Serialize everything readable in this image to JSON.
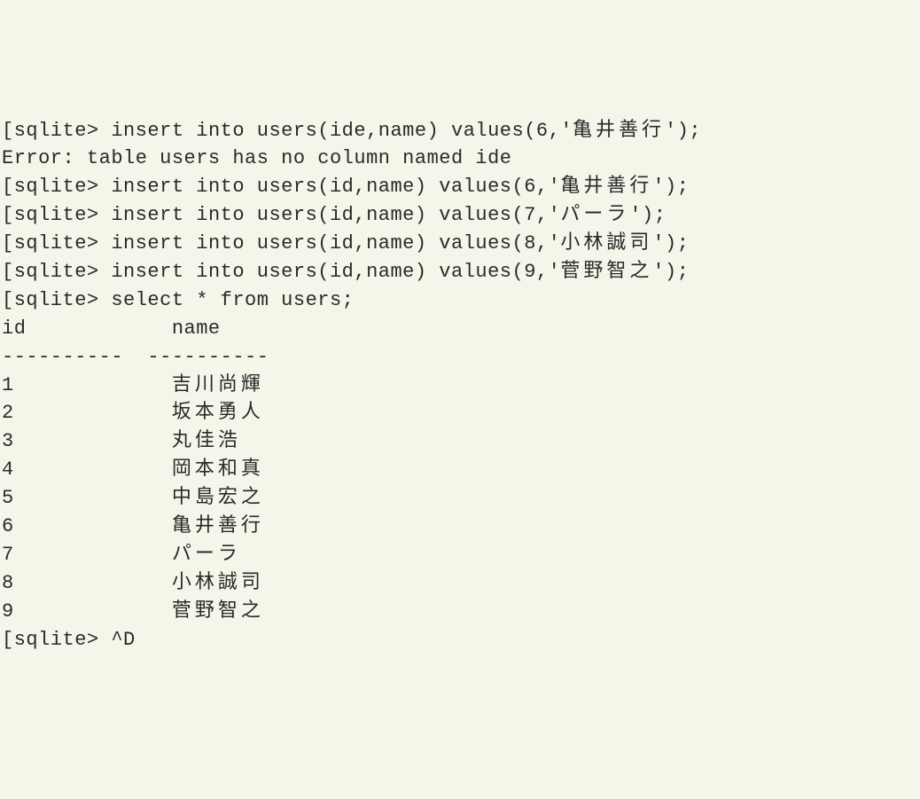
{
  "terminal": {
    "prompt": "sqlite> ",
    "commands": [
      {
        "text": "insert into users(ide,name) values(6,'",
        "cjk": "亀井善行",
        "suffix": "');"
      },
      {
        "error": "Error: table users has no column named ide"
      },
      {
        "text": "insert into users(id,name) values(6,'",
        "cjk": "亀井善行",
        "suffix": "');"
      },
      {
        "text": "insert into users(id,name) values(7,'",
        "cjk": "パーラ",
        "suffix": "');"
      },
      {
        "text": "insert into users(id,name) values(8,'",
        "cjk": "小林誠司",
        "suffix": "');"
      },
      {
        "text": "insert into users(id,name) values(9,'",
        "cjk": "菅野智之",
        "suffix": "');"
      },
      {
        "text": "select * from users;"
      }
    ],
    "result_header": {
      "col1": "id",
      "col2": "name",
      "sep1": "----------",
      "sep2": "----------"
    },
    "result_rows": [
      {
        "id": "1",
        "name": "吉川尚輝"
      },
      {
        "id": "2",
        "name": "坂本勇人"
      },
      {
        "id": "3",
        "name": "丸佳浩"
      },
      {
        "id": "4",
        "name": "岡本和真"
      },
      {
        "id": "5",
        "name": "中島宏之"
      },
      {
        "id": "6",
        "name": "亀井善行"
      },
      {
        "id": "7",
        "name": "パーラ"
      },
      {
        "id": "8",
        "name": "小林誠司"
      },
      {
        "id": "9",
        "name": "菅野智之"
      }
    ],
    "exit_command": "^D"
  }
}
